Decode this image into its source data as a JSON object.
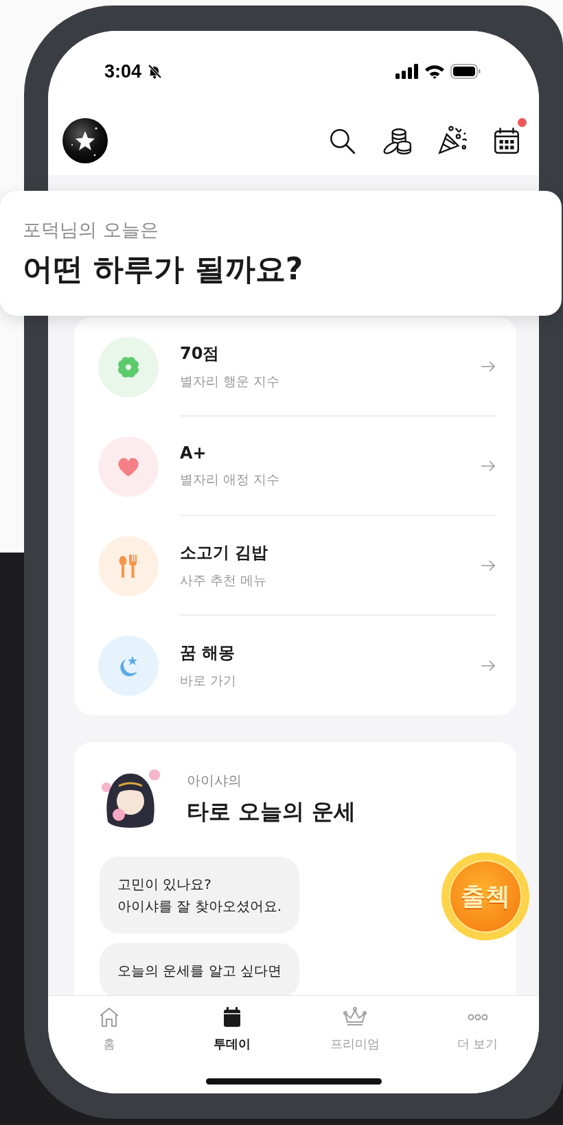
{
  "status_bar": {
    "time": "3:04",
    "silent": true
  },
  "header": {
    "actions": [
      {
        "kind": "search"
      },
      {
        "kind": "coins"
      },
      {
        "kind": "party"
      },
      {
        "kind": "calendar",
        "badge": true
      }
    ]
  },
  "banner": {
    "subtitle": "포덕님의 오늘은",
    "title": "어떤 하루가 될까요?"
  },
  "fortune_items": [
    {
      "kind": "clover",
      "value": "70점",
      "label": "별자리 행운 지수"
    },
    {
      "kind": "heart",
      "value": "A+",
      "label": "별자리 애정 지수"
    },
    {
      "kind": "meal",
      "value": "소고기 김밥",
      "label": "사주 추천 메뉴"
    },
    {
      "kind": "dream",
      "value": "꿈 해몽",
      "label": "바로 가기"
    }
  ],
  "tarot": {
    "caption": "아이샤의",
    "title": "타로 오늘의 운세",
    "messages": [
      "고민이 있나요?\n아이샤를 잘 찾아오셨어요.",
      "오늘의 운세를 알고 싶다면"
    ]
  },
  "attendance_button": {
    "label": "출첵"
  },
  "tab_bar": [
    {
      "kind": "home",
      "label": "홈",
      "selected": false
    },
    {
      "kind": "today",
      "label": "투데이",
      "selected": true
    },
    {
      "kind": "premium",
      "label": "프리미엄",
      "selected": false
    },
    {
      "kind": "more",
      "label": "더 보기",
      "selected": false
    }
  ]
}
